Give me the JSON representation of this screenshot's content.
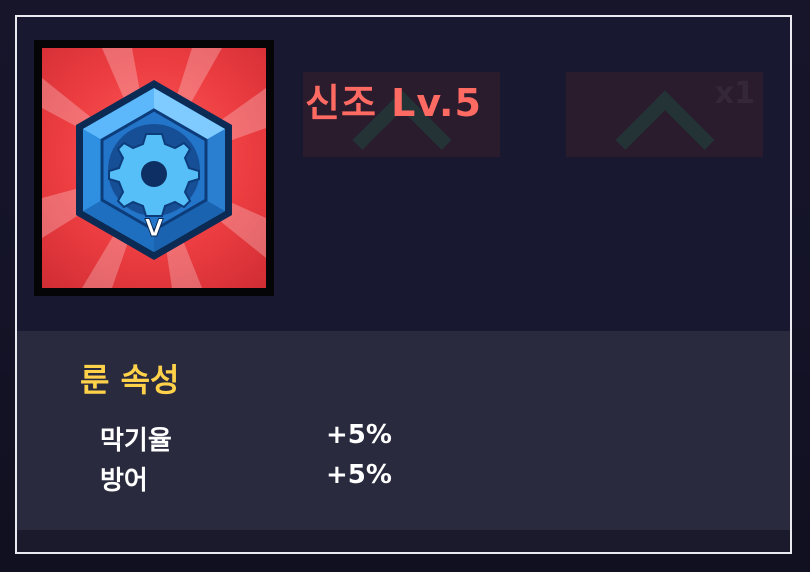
{
  "rune": {
    "name_level": "신조 Lv.5",
    "grade_letter": "V",
    "icon": "gear-gem-icon"
  },
  "background_cards": {
    "count_label": "x1"
  },
  "attributes": {
    "title": "룬 속성",
    "stats": [
      {
        "name": "막기율",
        "value": "+5%"
      },
      {
        "name": "방어",
        "value": "+5%"
      }
    ]
  },
  "colors": {
    "title": "#ff6a62",
    "section_title": "#ffd24a",
    "tile_red": "#ec3d41",
    "gem_blue": "#2f8fe0"
  }
}
